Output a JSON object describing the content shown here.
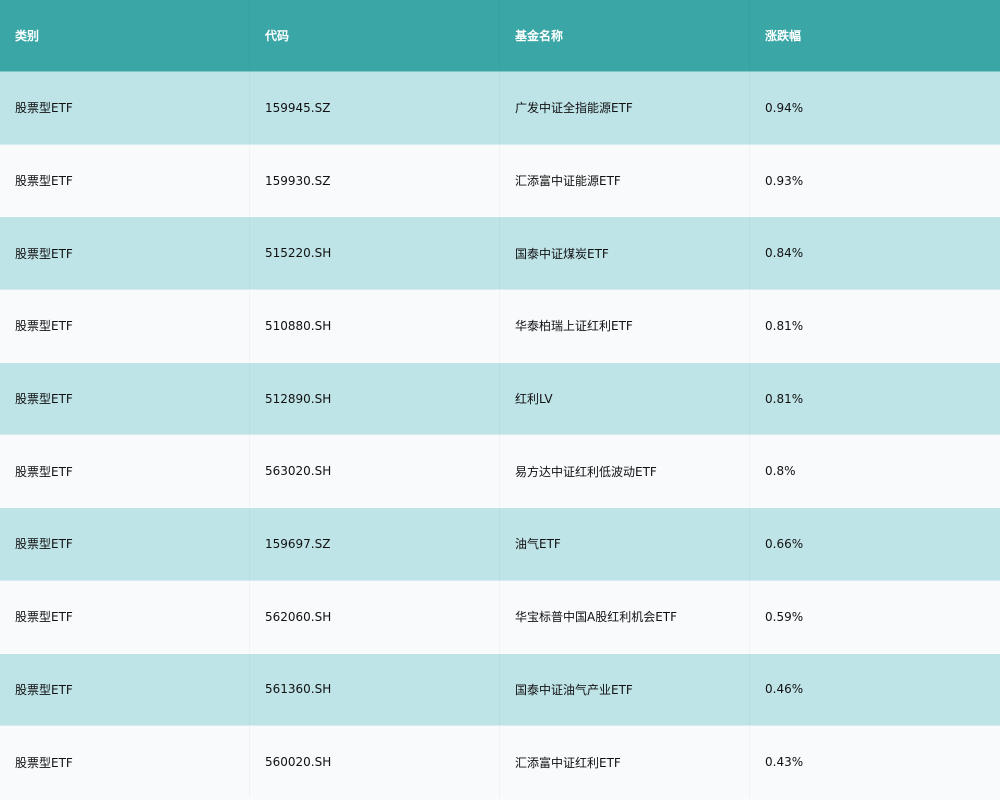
{
  "table": {
    "headers": [
      "类别",
      "代码",
      "基金名称",
      "涨跌幅"
    ],
    "rows": [
      [
        "股票型ETF",
        "159945.SZ",
        "广发中证全指能源ETF",
        "0.94%"
      ],
      [
        "股票型ETF",
        "159930.SZ",
        "汇添富中证能源ETF",
        "0.93%"
      ],
      [
        "股票型ETF",
        "515220.SH",
        "国泰中证煤炭ETF",
        "0.84%"
      ],
      [
        "股票型ETF",
        "510880.SH",
        "华泰柏瑞上证红利ETF",
        "0.81%"
      ],
      [
        "股票型ETF",
        "512890.SH",
        "红利LV",
        "0.81%"
      ],
      [
        "股票型ETF",
        "563020.SH",
        "易方达中证红利低波动ETF",
        "0.8%"
      ],
      [
        "股票型ETF",
        "159697.SZ",
        "油气ETF",
        "0.66%"
      ],
      [
        "股票型ETF",
        "562060.SH",
        "华宝标普中国A股红利机会ETF",
        "0.59%"
      ],
      [
        "股票型ETF",
        "561360.SH",
        "国泰中证油气产业ETF",
        "0.46%"
      ],
      [
        "股票型ETF",
        "560020.SH",
        "汇添富中证红利ETF",
        "0.43%"
      ]
    ]
  },
  "colors": {
    "header_background": "#3aa6a6",
    "odd_row_background": "#bfe4e8",
    "even_row_background": "#f8fafc",
    "header_text": "#ffffff",
    "body_text": "#111111"
  }
}
